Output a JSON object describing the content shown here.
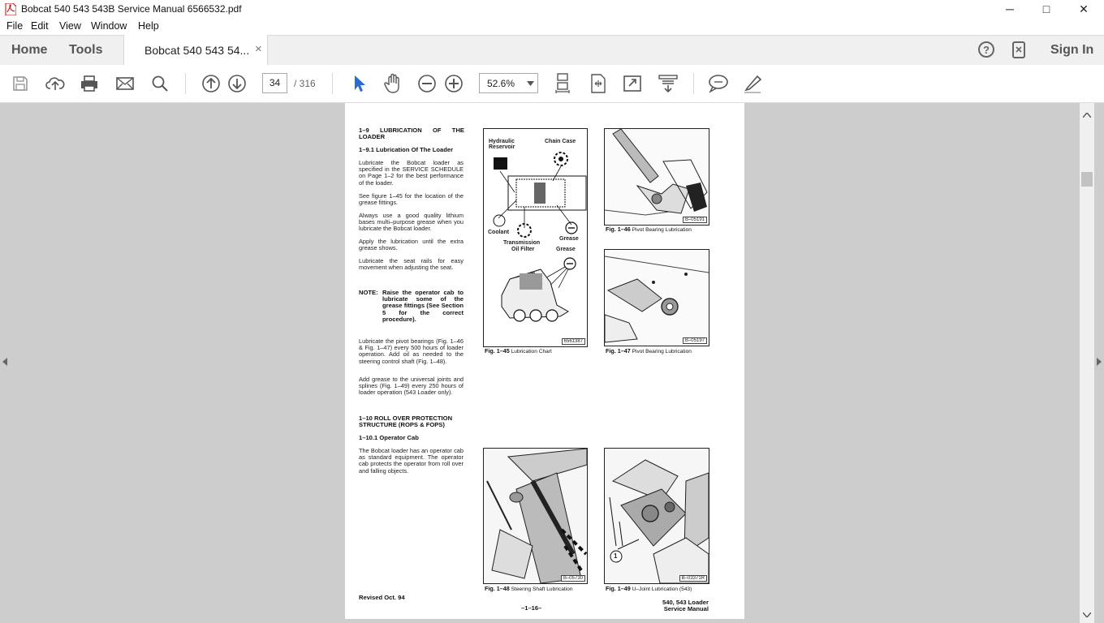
{
  "window": {
    "title": "Bobcat 540 543 543B Service Manual 6566532.pdf",
    "minimize": "─",
    "maximize": "□",
    "close": "✕"
  },
  "menu": [
    "File",
    "Edit",
    "View",
    "Window",
    "Help"
  ],
  "tabs": {
    "home": "Home",
    "tools": "Tools",
    "document": "Bobcat 540 543 54...",
    "close": "×",
    "help_icon": "?",
    "sign_in": "Sign In"
  },
  "toolbar": {
    "page_current": "34",
    "page_total": "/ 316",
    "zoom": "52.6%"
  },
  "doc": {
    "h1": "1–9 LUBRICATION OF THE LOADER",
    "h1_1": "1–9.1 Lubrication Of The Loader",
    "p1": "Lubricate the Bobcat loader as specified in the SERVICE SCHEDULE on Page 1–2 for the best performance of the loader.",
    "p2": "See figure 1–45 for the location of the grease fittings.",
    "p3": "Always use a good quality lithium bases multi–purpose grease when you lubricate the Bobcat loader.",
    "p4": "Apply the lubrication until the extra grease shows.",
    "p5": "Lubricate the seat rails for easy movement when adjusting the seat.",
    "note_label": "NOTE:",
    "note_text": "Raise the operator cab to lubricate some of the grease fittings (See Section 5 for the correct procedure).",
    "p6": "Lubricate the pivot bearings (Fig. 1–46 & Fig. 1–47) every 500 hours of loader operation. Add oil as needed to the steering control shaft (Fig. 1–48).",
    "p7": "Add grease to the universal joints and splines (Fig. 1–49) every 250 hours of loader operation (543 Loader only).",
    "h2": "1–10 ROLL OVER PROTECTION STRUCTURE (ROPS & FOPS)",
    "h2_1": "1–10.1 Operator Cab",
    "p8": "The Bobcat loader has an operator cab as standard equipment. The operator cab protects the operator from roll over and falling objects.",
    "revised": "Revised Oct. 94",
    "page_no": "–1–16–",
    "footer_right1": "540, 543 Loader",
    "footer_right2": "Service Manual"
  },
  "figures": {
    "f45": {
      "num": "Fig. 1–45",
      "title": "Lubrication Chart",
      "code": "6561387",
      "labels": {
        "hydraulic": "Hydraulic",
        "reservoir": "Reservoir",
        "chain": "Chain Case",
        "coolant": "Coolant",
        "trans1": "Transmission",
        "trans2": "Oil Filter",
        "grease1": "Grease",
        "grease2": "Grease"
      }
    },
    "f46": {
      "num": "Fig. 1–46",
      "title": "Pivot Bearing Lubrication",
      "code": "B–05191"
    },
    "f47": {
      "num": "Fig. 1–47",
      "title": "Pivot Bearing Lubrication",
      "code": "B–05197"
    },
    "f48": {
      "num": "Fig. 1–48",
      "title": "Steering Shaft Lubrication",
      "code": "B–05730"
    },
    "f49": {
      "num": "Fig. 1–49",
      "title": "U–Joint Lubrication (543)",
      "code": "B–03371R",
      "callout": "1"
    }
  }
}
